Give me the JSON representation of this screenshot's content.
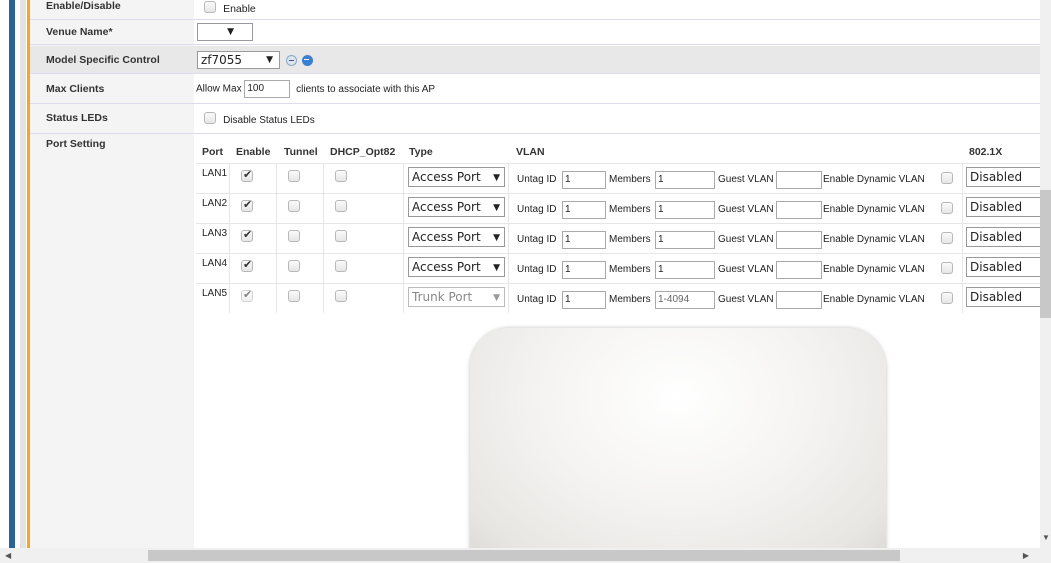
{
  "rows": {
    "enable_disable": {
      "label": "Enable/Disable",
      "checkbox_label": "Enable"
    },
    "venue_name": {
      "label": "Venue Name*",
      "value": ""
    },
    "model_specific": {
      "label": "Model Specific Control",
      "model": "zf7055"
    },
    "max_clients": {
      "label": "Max Clients",
      "prefix": "Allow Max",
      "value": "100",
      "suffix": "clients to associate with this AP"
    },
    "status_leds": {
      "label": "Status LEDs",
      "checkbox_label": "Disable Status LEDs"
    },
    "port_setting": {
      "label": "Port Setting"
    }
  },
  "port_table": {
    "headers": {
      "port": "Port",
      "enable": "Enable",
      "tunnel": "Tunnel",
      "dhcp": "DHCP_Opt82",
      "type": "Type",
      "vlan": "VLAN",
      "dot1x": "802.1X"
    },
    "labels": {
      "untag": "Untag ID",
      "members": "Members",
      "guest": "Guest VLAN",
      "dynamic": "Enable Dynamic VLAN"
    },
    "ports": [
      {
        "port": "LAN1",
        "enabled": true,
        "tunnel": false,
        "dhcp": false,
        "type": "Access Port",
        "untag": "1",
        "members": "1",
        "guest": "",
        "dynamic": false,
        "dot1x": "Disabled",
        "disabled": false
      },
      {
        "port": "LAN2",
        "enabled": true,
        "tunnel": false,
        "dhcp": false,
        "type": "Access Port",
        "untag": "1",
        "members": "1",
        "guest": "",
        "dynamic": false,
        "dot1x": "Disabled",
        "disabled": false
      },
      {
        "port": "LAN3",
        "enabled": true,
        "tunnel": false,
        "dhcp": false,
        "type": "Access Port",
        "untag": "1",
        "members": "1",
        "guest": "",
        "dynamic": false,
        "dot1x": "Disabled",
        "disabled": false
      },
      {
        "port": "LAN4",
        "enabled": true,
        "tunnel": false,
        "dhcp": false,
        "type": "Access Port",
        "untag": "1",
        "members": "1",
        "guest": "",
        "dynamic": false,
        "dot1x": "Disabled",
        "disabled": false
      },
      {
        "port": "LAN5",
        "enabled": true,
        "tunnel": false,
        "dhcp": false,
        "type": "Trunk Port",
        "untag": "1",
        "members": "1-4094",
        "guest": "",
        "dynamic": false,
        "dot1x": "Disabled",
        "disabled": true
      }
    ]
  },
  "colors": {
    "accent_orange": "#f5a623",
    "nav_blue": "#2a6496"
  }
}
